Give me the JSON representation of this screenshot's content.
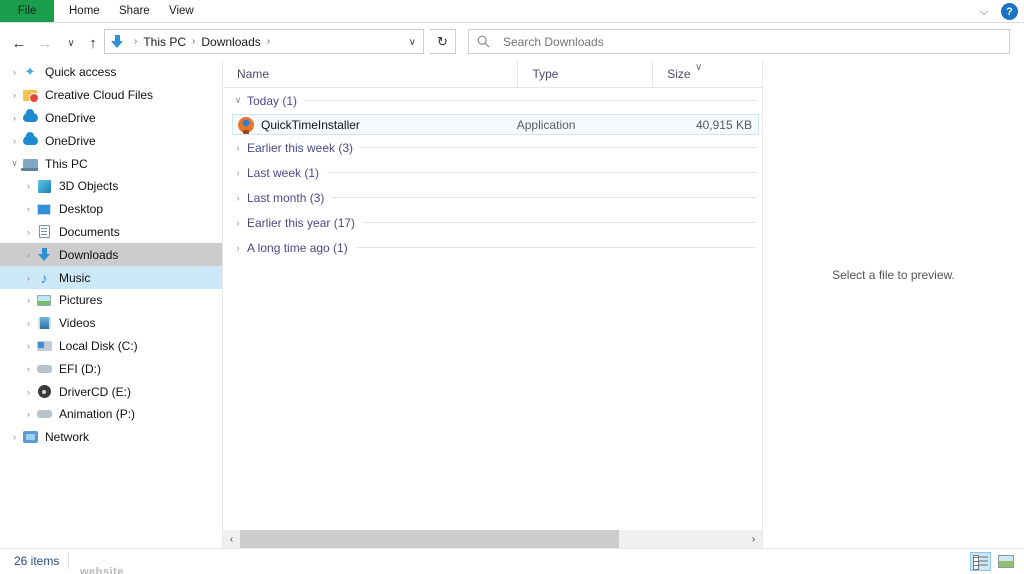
{
  "ribbon": {
    "file_tab": "File",
    "tabs": [
      "Home",
      "Share",
      "View"
    ],
    "chevron_icon": "chevron-down-icon",
    "help_label": "?"
  },
  "navbar": {
    "back_icon": "←",
    "forward_icon": "→",
    "recent_icon": "∨",
    "up_icon": "↑",
    "refresh_icon": "↻",
    "address_icon": "downloads-arrow-icon",
    "breadcrumbs": [
      "This PC",
      "Downloads"
    ],
    "crumb_sep": "›",
    "address_chevron": "∨",
    "search_placeholder": "Search Downloads",
    "search_value": ""
  },
  "sidebar": {
    "items": [
      {
        "label": "Quick access",
        "icon": "star-icon",
        "level": 0,
        "expander": "›",
        "state": ""
      },
      {
        "label": "Creative Cloud Files",
        "icon": "folder-cc-icon",
        "level": 0,
        "expander": "›",
        "state": ""
      },
      {
        "label": "OneDrive",
        "icon": "cloud-icon",
        "level": 0,
        "expander": "›",
        "state": ""
      },
      {
        "label": "OneDrive",
        "icon": "cloud-icon",
        "level": 0,
        "expander": "›",
        "state": ""
      },
      {
        "label": "This PC",
        "icon": "this-pc-icon",
        "level": 0,
        "expander": "∨",
        "state": ""
      },
      {
        "label": "3D Objects",
        "icon": "3d-objects-icon",
        "level": 1,
        "expander": "›",
        "state": ""
      },
      {
        "label": "Desktop",
        "icon": "desktop-icon",
        "level": 1,
        "expander": "›",
        "state": ""
      },
      {
        "label": "Documents",
        "icon": "documents-icon",
        "level": 1,
        "expander": "›",
        "state": ""
      },
      {
        "label": "Downloads",
        "icon": "downloads-icon",
        "level": 1,
        "expander": "›",
        "state": "selected"
      },
      {
        "label": "Music",
        "icon": "music-icon",
        "level": 1,
        "expander": "›",
        "state": "hovered"
      },
      {
        "label": "Pictures",
        "icon": "pictures-icon",
        "level": 1,
        "expander": "›",
        "state": ""
      },
      {
        "label": "Videos",
        "icon": "videos-icon",
        "level": 1,
        "expander": "›",
        "state": ""
      },
      {
        "label": "Local Disk (C:)",
        "icon": "local-disk-icon",
        "level": 1,
        "expander": "›",
        "state": ""
      },
      {
        "label": "EFI (D:)",
        "icon": "drive-icon",
        "level": 1,
        "expander": "›",
        "state": ""
      },
      {
        "label": "DriverCD (E:)",
        "icon": "cd-drive-icon",
        "level": 1,
        "expander": "›",
        "state": ""
      },
      {
        "label": "Animation (P:)",
        "icon": "drive-icon",
        "level": 1,
        "expander": "›",
        "state": ""
      },
      {
        "label": "Network",
        "icon": "network-icon",
        "level": 0,
        "expander": "›",
        "state": ""
      }
    ]
  },
  "filelist": {
    "columns": {
      "name": "Name",
      "type": "Type",
      "size": "Size"
    },
    "sort_indicator": "∨",
    "groups": [
      {
        "label": "Today (1)",
        "expanded": true,
        "chevron": "∨",
        "files": [
          {
            "name": "QuickTimeInstaller",
            "type": "Application",
            "size": "40,915 KB",
            "icon": "quicktime-icon",
            "selected": true
          }
        ]
      },
      {
        "label": "Earlier this week (3)",
        "expanded": false,
        "chevron": "›",
        "files": []
      },
      {
        "label": "Last week (1)",
        "expanded": false,
        "chevron": "›",
        "files": []
      },
      {
        "label": "Last month (3)",
        "expanded": false,
        "chevron": "›",
        "files": []
      },
      {
        "label": "Earlier this year (17)",
        "expanded": false,
        "chevron": "›",
        "files": []
      },
      {
        "label": "A long time ago (1)",
        "expanded": false,
        "chevron": "›",
        "files": []
      }
    ]
  },
  "preview": {
    "empty_text": "Select a file to preview."
  },
  "scrollbar": {
    "left_icon": "‹",
    "right_icon": "›",
    "thumb_percent": 75
  },
  "statusbar": {
    "item_count": "26 items",
    "views": [
      {
        "name": "details-view",
        "active": true
      },
      {
        "name": "large-icons-view",
        "active": false
      }
    ]
  },
  "background_bleed": {
    "text": "website"
  }
}
